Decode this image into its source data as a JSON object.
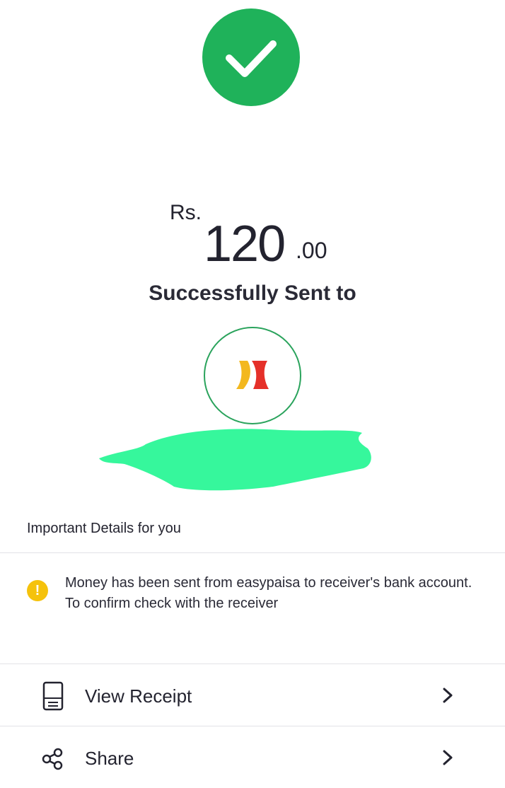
{
  "status": {
    "icon": "check-icon",
    "color": "#1fb25a"
  },
  "amount": {
    "currency": "Rs.",
    "whole": "120",
    "decimal": ".00"
  },
  "sent_label": "Successfully Sent to",
  "recipient": {
    "logo": "bank-logo-icon",
    "name_redacted": true
  },
  "details": {
    "title": "Important Details for you",
    "notice_icon": "exclamation-icon",
    "notice_icon_glyph": "!",
    "notice_color": "#f5c20c",
    "notice_text": "Money has been sent from easypaisa to receiver's bank account. To confirm check with the receiver"
  },
  "actions": [
    {
      "label": "View Receipt",
      "icon": "receipt-icon"
    },
    {
      "label": "Share",
      "icon": "share-icon"
    }
  ]
}
